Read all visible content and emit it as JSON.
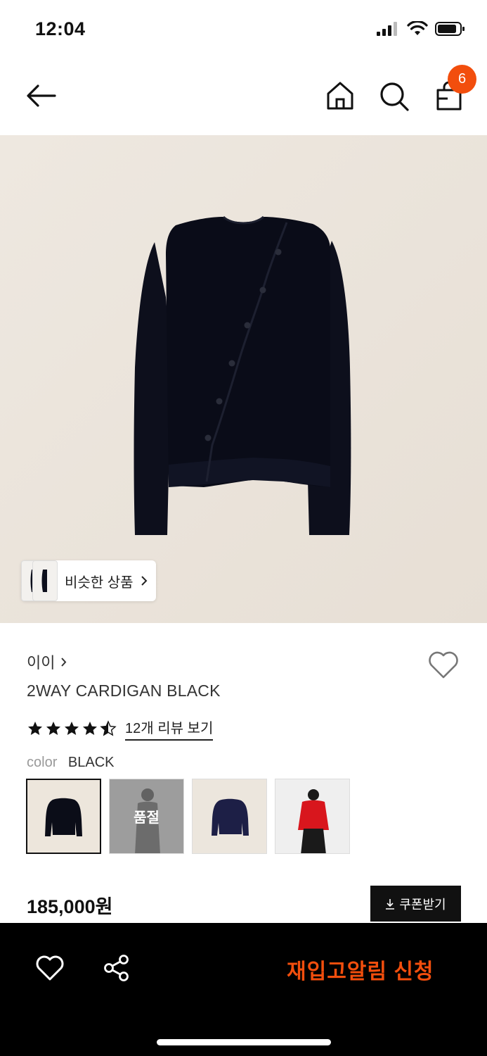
{
  "status_bar": {
    "time": "12:04"
  },
  "nav": {
    "cart_count": "6",
    "icons": [
      "back-arrow-icon",
      "home-icon",
      "search-icon",
      "shopping-bag-icon"
    ]
  },
  "image": {
    "similar_label": "비슷한 상품"
  },
  "product": {
    "brand": "이이",
    "name": "2WAY CARDIGAN BLACK",
    "rating": 4.5,
    "review_link": "12개 리뷰 보기",
    "color_label": "color",
    "color_value": "BLACK",
    "swatches": [
      {
        "selected": true
      },
      {
        "soldout_text": "품절"
      },
      {},
      {}
    ],
    "price": "185,000원",
    "coupon_label": "쿠폰받기"
  },
  "bottom_bar": {
    "restock_label": "재입고알림 신청"
  },
  "colors": {
    "accent": "#f24e0d",
    "image_bg": "#ebe4db"
  }
}
